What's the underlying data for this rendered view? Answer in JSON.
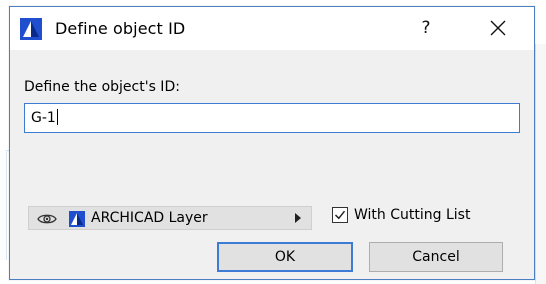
{
  "dialog": {
    "title": "Define object ID",
    "help_label": "?",
    "close_label": "✕",
    "prompt_label": "Define the object's ID:",
    "id_value": "G-1"
  },
  "layer": {
    "name": "ARCHICAD Layer",
    "eye_icon": "eye-icon",
    "layer_icon": "archicad-layer-icon"
  },
  "options": {
    "with_cutting_list_label": "With Cutting List",
    "with_cutting_list_checked": true
  },
  "buttons": {
    "ok_label": "OK",
    "cancel_label": "Cancel"
  },
  "colors": {
    "accent": "#3d7bd4",
    "dialog_bg": "#f0f0f0",
    "button_bg": "#e1e1e1",
    "icon_blue": "#1f4fcf"
  }
}
